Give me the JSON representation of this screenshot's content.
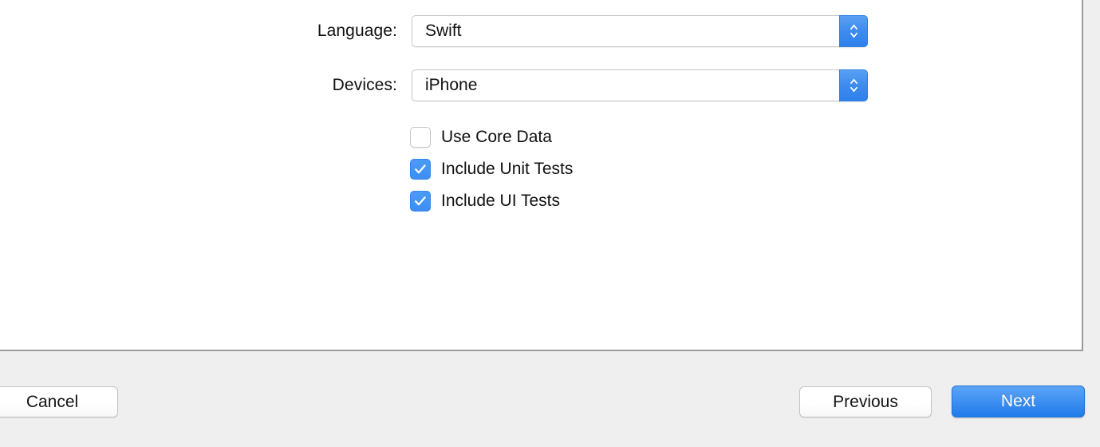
{
  "dialog": {
    "accent_color": "#3d8bef",
    "content_background": "#ffffff",
    "bar_background": "#efefef",
    "divider_color": "#9a9a9a"
  },
  "form": {
    "rows": [
      {
        "label": "Language:",
        "value": "Swift",
        "control": "popup-button",
        "stepper_icon": "chevron-up-down-icon"
      },
      {
        "label": "Devices:",
        "value": "iPhone",
        "control": "popup-button",
        "stepper_icon": "chevron-up-down-icon"
      }
    ],
    "checkboxes": [
      {
        "label": "Use Core Data",
        "checked": false
      },
      {
        "label": "Include Unit Tests",
        "checked": true
      },
      {
        "label": "Include UI Tests",
        "checked": true
      }
    ]
  },
  "footer": {
    "cancel_label": "Cancel",
    "previous_label": "Previous",
    "next_label": "Next"
  }
}
